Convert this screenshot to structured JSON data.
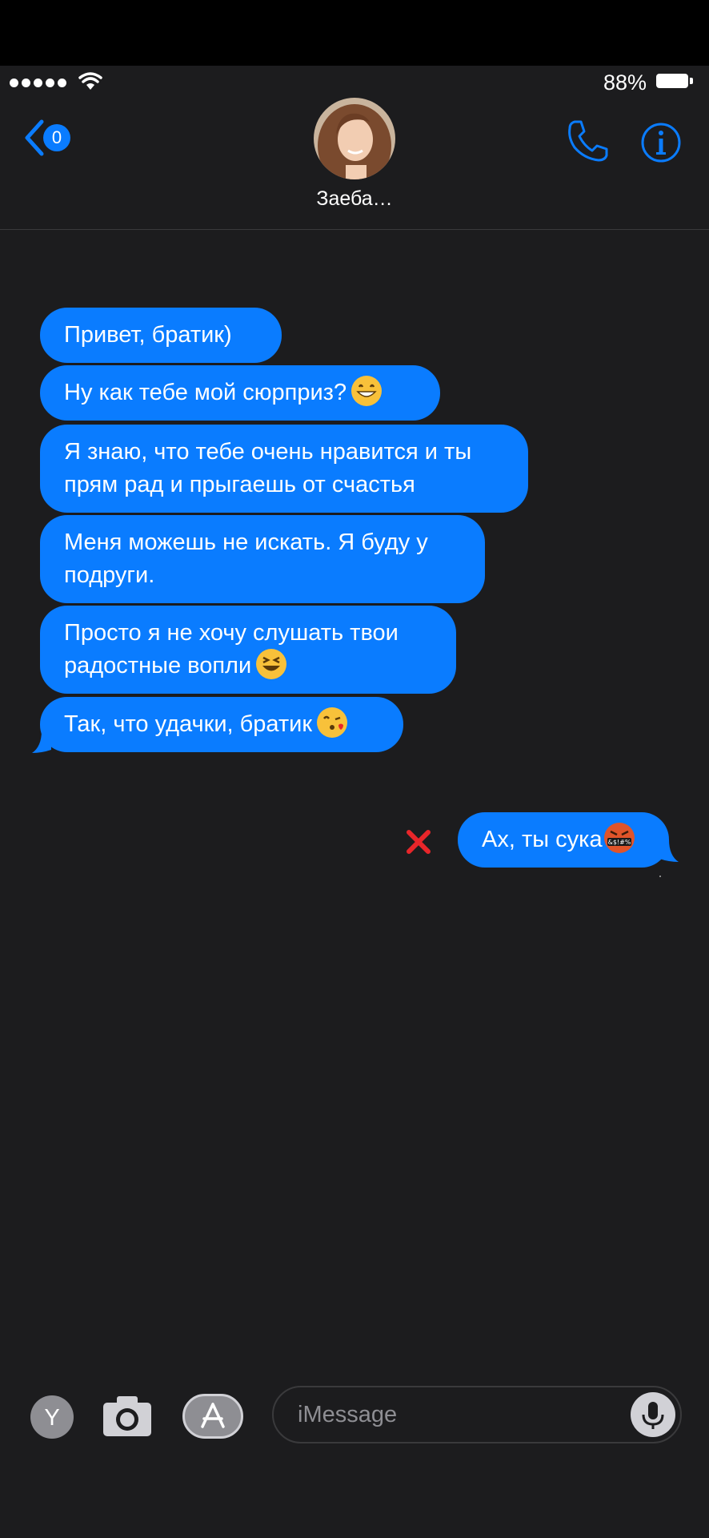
{
  "status_bar": {
    "battery": "88%"
  },
  "header": {
    "back_count": "0",
    "contact_name": "Заеба…"
  },
  "messages": {
    "incoming": [
      {
        "text": "Привет, братик)"
      },
      {
        "text": "Ну как тебе мой сюрприз?",
        "emoji": "grinning-face-icon"
      },
      {
        "line1": "Я знаю, что тебе очень нравится и ты",
        "line2": "прям рад и прыгаешь от счастья"
      },
      {
        "line1": "Меня можешь не искать. Я буду у",
        "line2": "подруги."
      },
      {
        "line1": "Просто я не хочу слушать твои",
        "line2": "радостные вопли",
        "emoji": "laughing-face-icon"
      },
      {
        "text": "Так, что удачки, братик",
        "emoji": "kissing-face-icon"
      }
    ],
    "outgoing": [
      {
        "text": "Ах, ты сука",
        "emoji": "cursing-face-icon",
        "symbols": "&$!#%",
        "failed": true
      }
    ]
  },
  "input_bar": {
    "app_button_label": "Y",
    "placeholder": "iMessage"
  },
  "colors": {
    "bubble": "#0a7cff",
    "background": "#1c1c1e",
    "accent": "#0a7cff",
    "error": "#e8262a"
  }
}
